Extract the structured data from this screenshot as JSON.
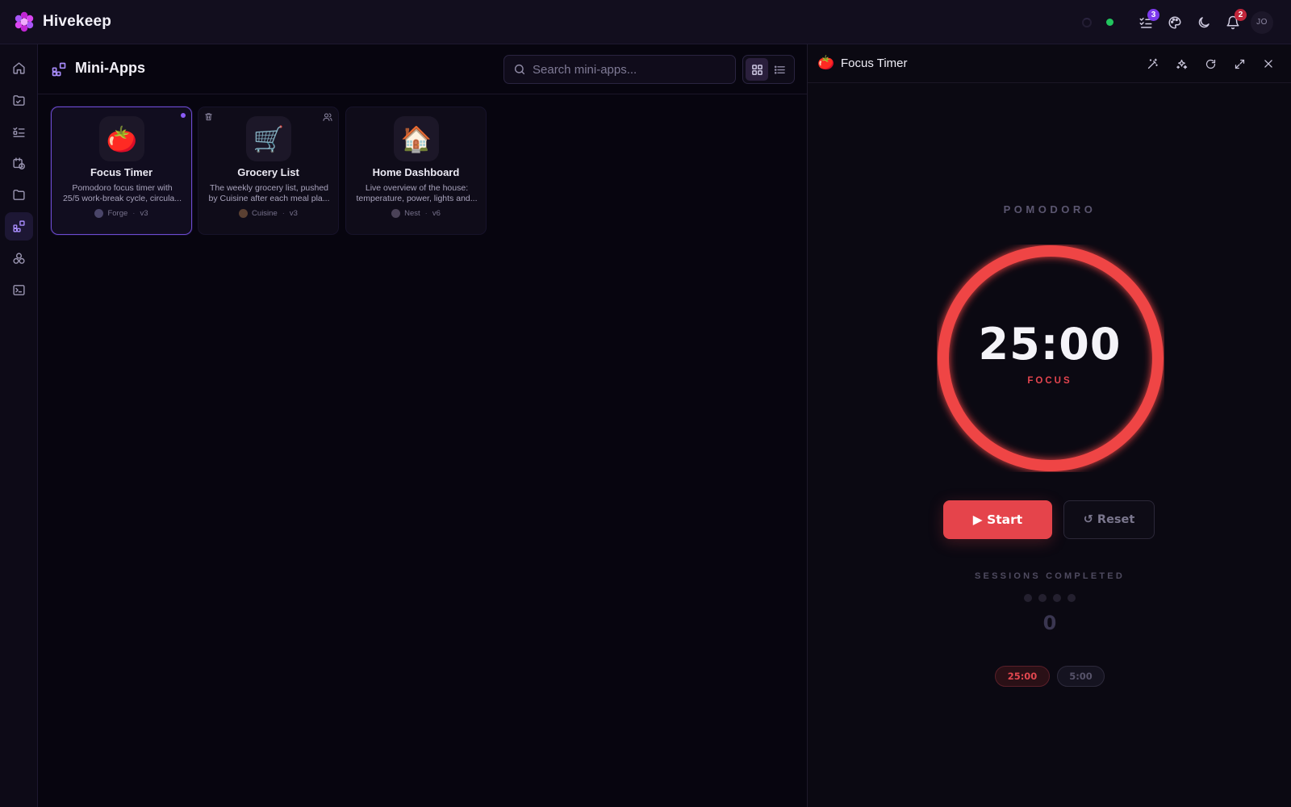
{
  "app": {
    "name": "Hivekeep"
  },
  "topbar": {
    "tasks_badge": "3",
    "notifications_badge": "2",
    "avatar_initials": "JO",
    "status_color": "#22c55e"
  },
  "rail": {
    "items": [
      {
        "name": "home-icon"
      },
      {
        "name": "calendar-folder-icon"
      },
      {
        "name": "tasks-icon"
      },
      {
        "name": "schedule-icon"
      },
      {
        "name": "folder-icon"
      },
      {
        "name": "mini-apps-icon",
        "active": true
      },
      {
        "name": "integrations-icon"
      },
      {
        "name": "terminal-icon"
      }
    ]
  },
  "main": {
    "title": "Mini-Apps",
    "search_placeholder": "Search mini-apps...",
    "cards": [
      {
        "emoji": "🍅",
        "title": "Focus Timer",
        "desc1": "Pomodoro focus timer with",
        "desc2": "25/5 work-break cycle, circula...",
        "author": "Forge",
        "version": "v3"
      },
      {
        "emoji": "🛒",
        "title": "Grocery List",
        "desc1": "The weekly grocery list, pushed",
        "desc2": "by Cuisine after each meal pla...",
        "author": "Cuisine",
        "version": "v3"
      },
      {
        "emoji": "🏠",
        "title": "Home Dashboard",
        "desc1": "Live overview of the house:",
        "desc2": "temperature, power, lights and...",
        "author": "Nest",
        "version": "v6"
      }
    ]
  },
  "panel": {
    "emoji": "🍅",
    "title": "Focus Timer",
    "pomodoro_label": "POMODORO",
    "timer": "25:00",
    "mode": "FOCUS",
    "progress": 1.0,
    "accent_color": "#ef4444",
    "start_label": "▶ Start",
    "reset_label": "↺ Reset",
    "sessions_label": "SESSIONS COMPLETED",
    "sessions_count": "0",
    "session_slots": 4,
    "preset_focus": "25:00",
    "preset_break": "5:00"
  }
}
